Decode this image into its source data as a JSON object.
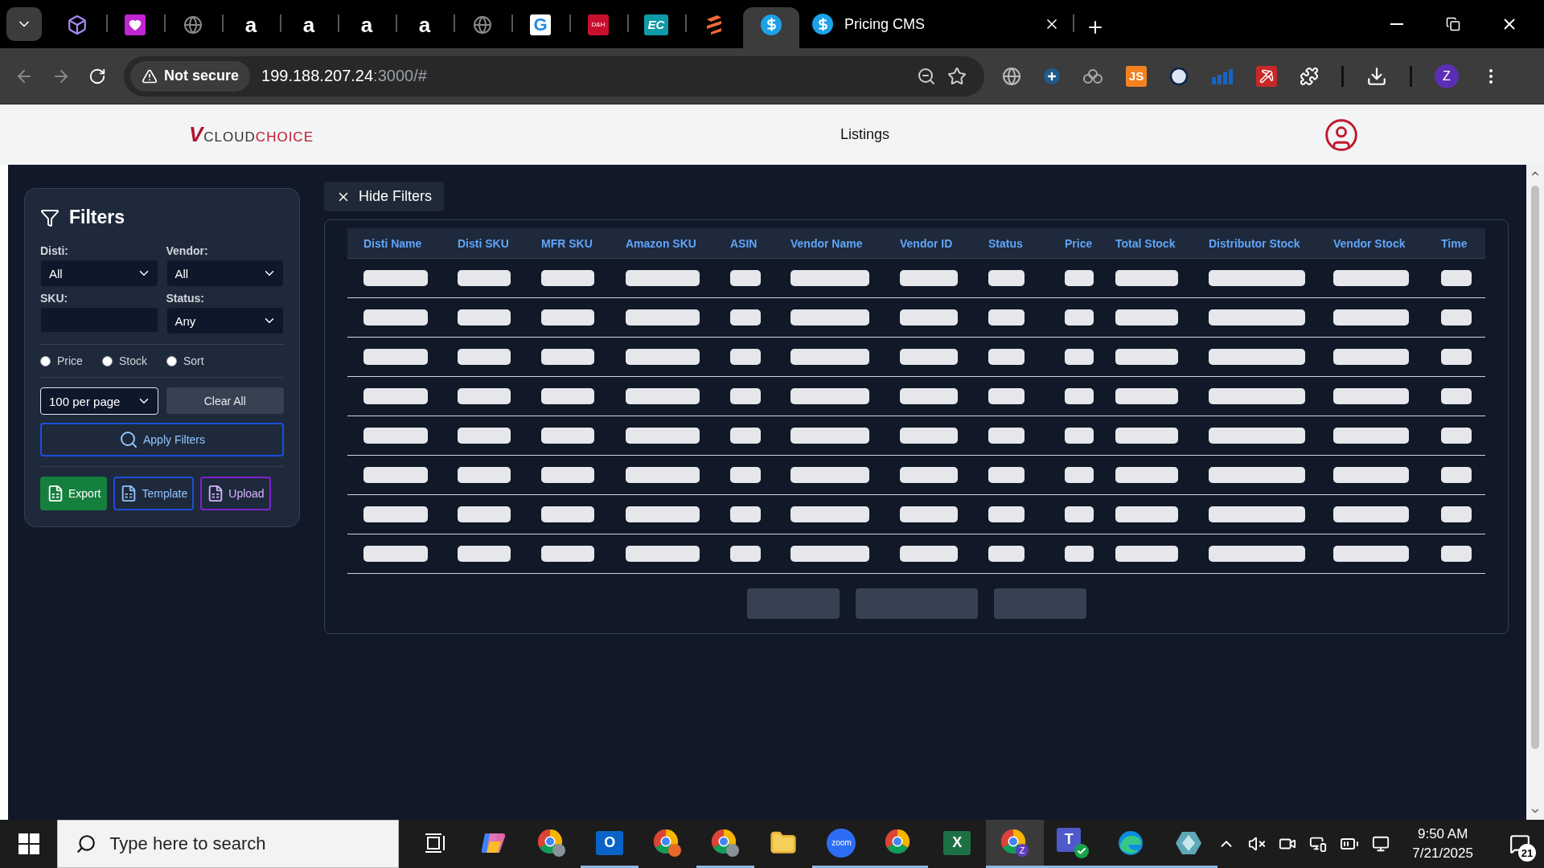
{
  "browser": {
    "pinned_tabs": [
      {
        "kind": "cube",
        "selected": false
      },
      {
        "kind": "heart",
        "selected": false
      },
      {
        "kind": "globe",
        "selected": false
      },
      {
        "kind": "amazon",
        "glyph": "a",
        "selected": false
      },
      {
        "kind": "amazon",
        "glyph": "a",
        "selected": false
      },
      {
        "kind": "amazon",
        "glyph": "a",
        "selected": false
      },
      {
        "kind": "amazon",
        "glyph": "a",
        "selected": false
      },
      {
        "kind": "globe",
        "selected": false
      },
      {
        "kind": "g-logo",
        "glyph": "G",
        "selected": false
      },
      {
        "kind": "dh",
        "glyph": "D&H",
        "selected": false
      },
      {
        "kind": "ec",
        "glyph": "EC",
        "selected": false
      },
      {
        "kind": "stack",
        "selected": false
      },
      {
        "kind": "dollar",
        "selected": true
      }
    ],
    "tab": {
      "title": "Pricing CMS",
      "selected": false
    },
    "address": {
      "security": "Not secure",
      "host": "199.188.207.24",
      "path": ":3000/#"
    },
    "extensions": [
      {
        "kind": "globe"
      },
      {
        "kind": "cross"
      },
      {
        "kind": "rings"
      },
      {
        "kind": "js",
        "glyph": "JS"
      },
      {
        "kind": "circle"
      },
      {
        "kind": "bars"
      },
      {
        "kind": "pick"
      },
      {
        "kind": "puzzle"
      }
    ],
    "profile": "Z"
  },
  "header": {
    "logo": {
      "mark": "V",
      "first": "CLOUD",
      "second": "CHOICE"
    },
    "nav": "Listings"
  },
  "filters": {
    "title": "Filters",
    "fields": [
      {
        "kind": "select",
        "label": "Disti:",
        "value": "All"
      },
      {
        "kind": "select",
        "label": "Vendor:",
        "value": "All"
      },
      {
        "kind": "text",
        "label": "SKU:"
      },
      {
        "kind": "select",
        "label": "Status:",
        "value": "Any"
      }
    ],
    "radios": [
      {
        "label": "Price",
        "checked": false
      },
      {
        "label": "Stock",
        "checked": false
      },
      {
        "label": "Sort",
        "checked": false
      }
    ],
    "per_page": "100 per page",
    "clear": "Clear All",
    "apply": "Apply Filters",
    "actions": [
      {
        "kind": "export",
        "label": "Export"
      },
      {
        "kind": "template",
        "label": "Template"
      },
      {
        "kind": "upload",
        "label": "Upload"
      }
    ]
  },
  "hide_filters": "Hide Filters",
  "table": {
    "columns": [
      "Disti Name",
      "Disti SKU",
      "MFR SKU",
      "Amazon SKU",
      "ASIN",
      "Vendor Name",
      "Vendor ID",
      "Status",
      "Price",
      "Total Stock",
      "Distributor Stock",
      "Vendor Stock",
      "Time"
    ],
    "rows": [
      {
        "kind": "skeleton"
      },
      {
        "kind": "skeleton"
      },
      {
        "kind": "skeleton"
      },
      {
        "kind": "skeleton"
      },
      {
        "kind": "skeleton"
      },
      {
        "kind": "skeleton"
      },
      {
        "kind": "skeleton"
      },
      {
        "kind": "skeleton"
      }
    ],
    "pagination": [
      {
        "kind": "skeleton"
      },
      {
        "kind": "skeleton"
      },
      {
        "kind": "skeleton"
      }
    ]
  },
  "taskbar": {
    "search": {
      "placeholder": "Type here to search"
    },
    "apps": [
      {
        "kind": "taskview",
        "running": false,
        "selected": false
      },
      {
        "kind": "copilot",
        "running": false,
        "selected": false
      },
      {
        "kind": "chrome",
        "color": "#8a9299",
        "running": false,
        "selected": false
      },
      {
        "kind": "outlook",
        "glyph": "O",
        "running": true,
        "selected": false
      },
      {
        "kind": "chrome",
        "color": "#e86a2b",
        "running": false,
        "selected": false
      },
      {
        "kind": "chrome",
        "color": "#8a9299",
        "running": true,
        "selected": false
      },
      {
        "kind": "explorer",
        "running": false,
        "selected": false
      },
      {
        "kind": "zoom",
        "glyph": "zoom",
        "running": true,
        "selected": false
      },
      {
        "kind": "chrome",
        "running": true,
        "selected": false
      },
      {
        "kind": "excel",
        "glyph": "X",
        "running": false,
        "selected": false
      },
      {
        "kind": "chrome",
        "color": "#5b3dbe",
        "glyph": "Z",
        "running": true,
        "selected": true
      },
      {
        "kind": "teams",
        "glyph": "T",
        "running": true,
        "selected": false
      },
      {
        "kind": "edge",
        "running": true,
        "selected": false
      },
      {
        "kind": "diamond",
        "running": true,
        "selected": false
      }
    ],
    "time": "9:50 AM",
    "date": "7/21/2025",
    "notifications": "21"
  }
}
